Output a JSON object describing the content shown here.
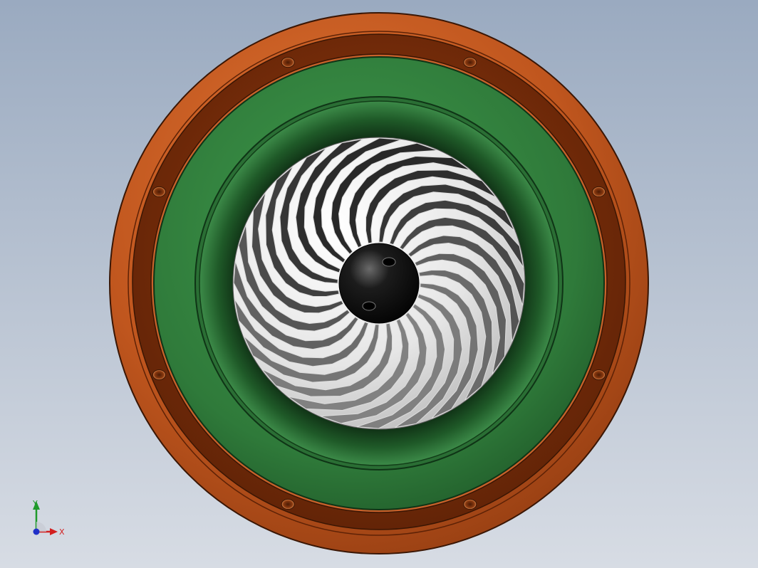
{
  "viewport": {
    "background_top": "#9aaac0",
    "background_bottom": "#d7dce4"
  },
  "model": {
    "housing_color": "#c0561e",
    "housing_dark_color": "#7c2e08",
    "shroud_color": "#2f7a3a",
    "impeller_blade_color": "#b8b8b8",
    "hub_color": "#0e0e0e",
    "housing_bolt_holes": 8,
    "impeller_blades": 24
  },
  "triad": {
    "x_label": "X",
    "y_label": "Y",
    "x_color": "#d32020",
    "y_color": "#1f9a2a",
    "z_color": "#2030c8"
  }
}
